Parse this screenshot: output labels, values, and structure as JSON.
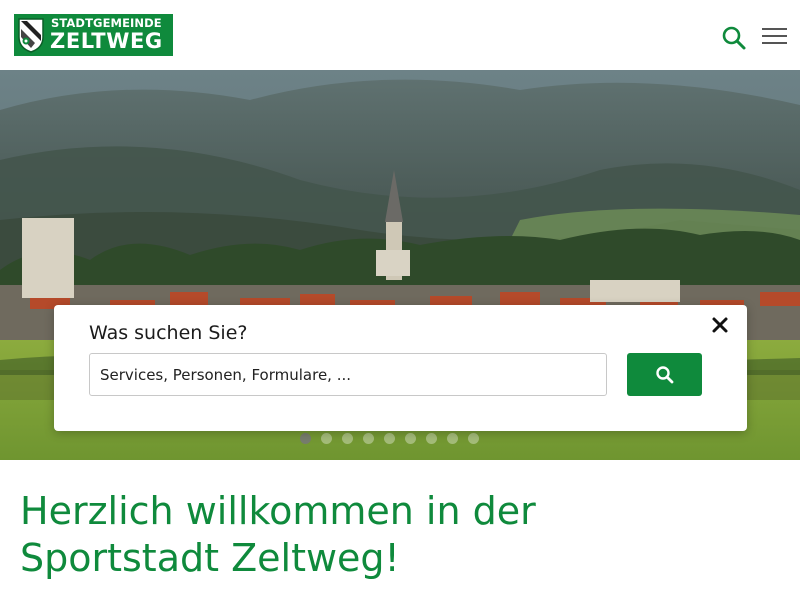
{
  "header": {
    "logo": {
      "line1": "STADTGEMEINDE",
      "line2": "ZELTWEG"
    },
    "search_icon": "search-icon",
    "menu_icon": "hamburger-menu-icon"
  },
  "colors": {
    "brand_green": "#0f8a3c",
    "text_dark": "#1c1c1c"
  },
  "hero": {
    "carousel": {
      "slide_count": 9,
      "active_index": 0
    }
  },
  "search": {
    "title": "Was suchen Sie?",
    "placeholder": "Services, Personen, Formulare, ...",
    "value": "",
    "close_icon": "close-icon",
    "button_icon": "search-icon"
  },
  "main": {
    "welcome_line1": "Herzlich willkommen in der",
    "welcome_line2": "Sportstadt Zeltweg!"
  }
}
